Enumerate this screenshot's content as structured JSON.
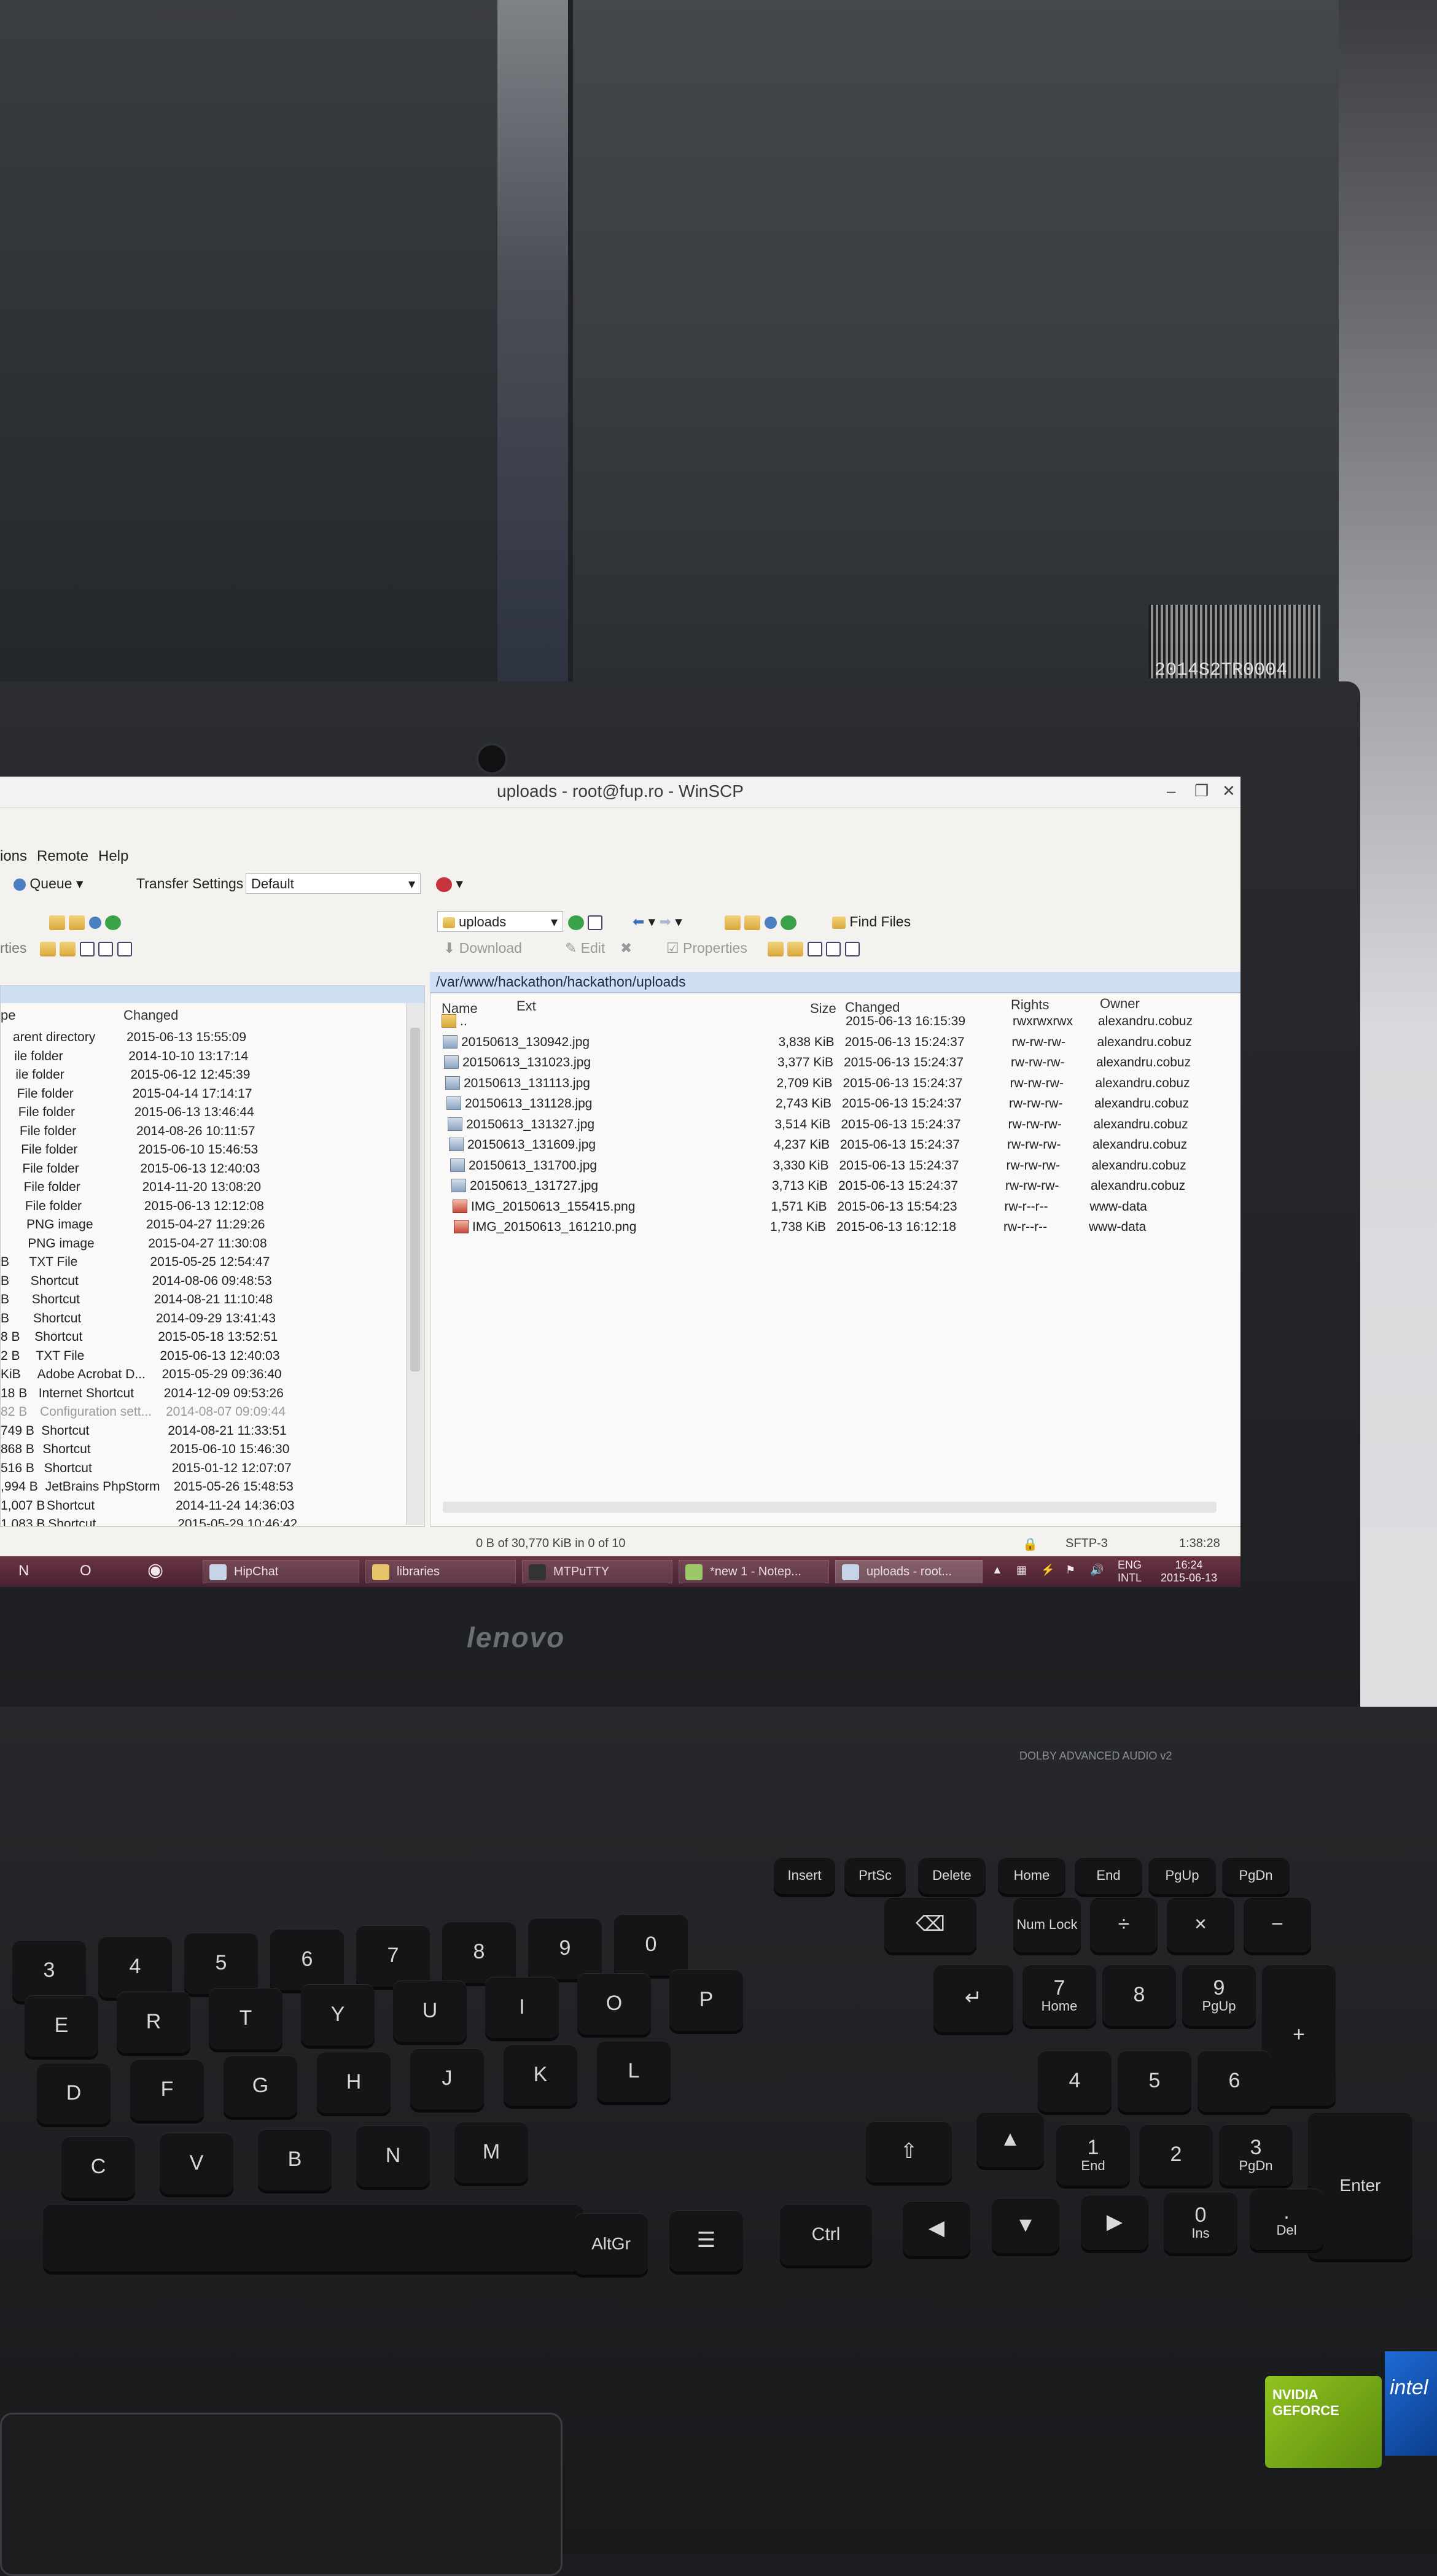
{
  "window": {
    "title": "uploads - root@fup.ro - WinSCP",
    "minimize": "–",
    "maximize": "❐",
    "close": "✕"
  },
  "menu": [
    "ions",
    "Remote",
    "Help"
  ],
  "toolbar": {
    "queue": "Queue",
    "transfer_settings": "Transfer Settings",
    "transfer_default": "Default",
    "remote_folder": "uploads",
    "find_files": "Find Files",
    "download": "Download",
    "edit": "Edit",
    "properties": "Properties",
    "left_props": "rties"
  },
  "remote_path": "/var/www/hackathon/hackathon/uploads",
  "left_pane": {
    "headers": {
      "type": "pe",
      "changed": "Changed"
    },
    "rows": [
      {
        "size": "",
        "type": "arent directory",
        "changed": "2015-06-13 15:55:09"
      },
      {
        "size": "",
        "type": "ile folder",
        "changed": "2014-10-10 13:17:14"
      },
      {
        "size": "",
        "type": "ile folder",
        "changed": "2015-06-12 12:45:39"
      },
      {
        "size": "",
        "type": "File folder",
        "changed": "2015-04-14 17:14:17"
      },
      {
        "size": "",
        "type": "File folder",
        "changed": "2015-06-13 13:46:44"
      },
      {
        "size": "",
        "type": "File folder",
        "changed": "2014-08-26 10:11:57"
      },
      {
        "size": "",
        "type": "File folder",
        "changed": "2015-06-10 15:46:53"
      },
      {
        "size": "",
        "type": "File folder",
        "changed": "2015-06-13 12:40:03"
      },
      {
        "size": "",
        "type": "File folder",
        "changed": "2014-11-20 13:08:20"
      },
      {
        "size": "",
        "type": "File folder",
        "changed": "2015-06-13 12:12:08"
      },
      {
        "size": "",
        "type": "PNG image",
        "changed": "2015-04-27 11:29:26"
      },
      {
        "size": "",
        "type": "PNG image",
        "changed": "2015-04-27 11:30:08"
      },
      {
        "size": "B",
        "type": "TXT File",
        "changed": "2015-05-25 12:54:47"
      },
      {
        "size": "B",
        "type": "Shortcut",
        "changed": "2014-08-06 09:48:53"
      },
      {
        "size": "B",
        "type": "Shortcut",
        "changed": "2014-08-21 11:10:48"
      },
      {
        "size": "B",
        "type": "Shortcut",
        "changed": "2014-09-29 13:41:43"
      },
      {
        "size": "8 B",
        "type": "Shortcut",
        "changed": "2015-05-18 13:52:51"
      },
      {
        "size": "2 B",
        "type": "TXT File",
        "changed": "2015-06-13 12:40:03"
      },
      {
        "size": "KiB",
        "type": "Adobe Acrobat D...",
        "changed": "2015-05-29 09:36:40"
      },
      {
        "size": "18 B",
        "type": "Internet Shortcut",
        "changed": "2014-12-09 09:53:26"
      },
      {
        "size": "82 B",
        "type": "Configuration sett...",
        "changed": "2014-08-07 09:09:44"
      },
      {
        "size": "749 B",
        "type": "Shortcut",
        "changed": "2014-08-21 11:33:51"
      },
      {
        "size": "868 B",
        "type": "Shortcut",
        "changed": "2015-06-10 15:46:30"
      },
      {
        "size": "516 B",
        "type": "Shortcut",
        "changed": "2015-01-12 12:07:07"
      },
      {
        "size": ",994 B",
        "type": "JetBrains PhpStorm",
        "changed": "2015-05-26 15:48:53"
      },
      {
        "size": "1,007 B",
        "type": "Shortcut",
        "changed": "2014-11-24 14:36:03"
      },
      {
        "size": "1,083 B",
        "type": "Shortcut",
        "changed": "2015-05-29 10:46:42"
      }
    ]
  },
  "right_pane": {
    "headers": {
      "name": "Name",
      "ext": "Ext",
      "size": "Size",
      "changed": "Changed",
      "rights": "Rights",
      "owner": "Owner"
    },
    "rows": [
      {
        "icon": "up",
        "name": "..",
        "size": "",
        "changed": "2015-06-13 16:15:39",
        "rights": "rwxrwxrwx",
        "owner": "alexandru.cobuz"
      },
      {
        "icon": "jpg",
        "name": "20150613_130942.jpg",
        "size": "3,838 KiB",
        "changed": "2015-06-13 15:24:37",
        "rights": "rw-rw-rw-",
        "owner": "alexandru.cobuz"
      },
      {
        "icon": "jpg",
        "name": "20150613_131023.jpg",
        "size": "3,377 KiB",
        "changed": "2015-06-13 15:24:37",
        "rights": "rw-rw-rw-",
        "owner": "alexandru.cobuz"
      },
      {
        "icon": "jpg",
        "name": "20150613_131113.jpg",
        "size": "2,709 KiB",
        "changed": "2015-06-13 15:24:37",
        "rights": "rw-rw-rw-",
        "owner": "alexandru.cobuz"
      },
      {
        "icon": "jpg",
        "name": "20150613_131128.jpg",
        "size": "2,743 KiB",
        "changed": "2015-06-13 15:24:37",
        "rights": "rw-rw-rw-",
        "owner": "alexandru.cobuz"
      },
      {
        "icon": "jpg",
        "name": "20150613_131327.jpg",
        "size": "3,514 KiB",
        "changed": "2015-06-13 15:24:37",
        "rights": "rw-rw-rw-",
        "owner": "alexandru.cobuz"
      },
      {
        "icon": "jpg",
        "name": "20150613_131609.jpg",
        "size": "4,237 KiB",
        "changed": "2015-06-13 15:24:37",
        "rights": "rw-rw-rw-",
        "owner": "alexandru.cobuz"
      },
      {
        "icon": "jpg",
        "name": "20150613_131700.jpg",
        "size": "3,330 KiB",
        "changed": "2015-06-13 15:24:37",
        "rights": "rw-rw-rw-",
        "owner": "alexandru.cobuz"
      },
      {
        "icon": "jpg",
        "name": "20150613_131727.jpg",
        "size": "3,713 KiB",
        "changed": "2015-06-13 15:24:37",
        "rights": "rw-rw-rw-",
        "owner": "alexandru.cobuz"
      },
      {
        "icon": "png",
        "name": "IMG_20150613_155415.png",
        "size": "1,571 KiB",
        "changed": "2015-06-13 15:54:23",
        "rights": "rw-r--r--",
        "owner": "www-data"
      },
      {
        "icon": "png",
        "name": "IMG_20150613_161210.png",
        "size": "1,738 KiB",
        "changed": "2015-06-13 16:12:18",
        "rights": "rw-r--r--",
        "owner": "www-data"
      }
    ]
  },
  "status": {
    "selection": "0 B of 30,770 KiB in 0 of 10",
    "protocol": "SFTP-3",
    "elapsed": "1:38:28"
  },
  "taskbar": {
    "items": [
      "HipChat",
      "libraries",
      "MTPuTTY",
      "*new 1 - Notep...",
      "uploads - root..."
    ],
    "lang": "ENG",
    "layout": "INTL",
    "time": "16:24",
    "date": "2015-06-13"
  },
  "laptop": {
    "brand": "lenovo",
    "dolby": "DOLBY ADVANCED AUDIO v2",
    "nvidia": "NVIDIA GEFORCE",
    "intel": "intel",
    "monitor_sticker": "2014S2TR0004"
  },
  "keys": {
    "insert": "Insert",
    "prtsc": "PrtSc",
    "delete": "Delete",
    "home": "Home",
    "end": "End",
    "pgup": "PgUp",
    "pgdn": "PgDn",
    "numlock": "Num Lock",
    "divide": "÷",
    "multiply": "×",
    "minus": "−",
    "plus": "+",
    "backspace": "⌫",
    "enter_main": "↵",
    "n7": "7",
    "n7sub": "Home",
    "n8": "8",
    "n9": "9",
    "n9sub": "PgUp",
    "n4": "4",
    "n5": "5",
    "n6": "6",
    "n1": "1",
    "n1sub": "End",
    "n2": "2",
    "n3": "3",
    "n3sub": "PgDn",
    "n0": "0",
    "n0sub": "Ins",
    "ndot": ".",
    "ndotsub": "Del",
    "enter": "Enter",
    "altgr": "AltGr",
    "menu": "☰",
    "ctrl": "Ctrl",
    "left": "◀",
    "down": "▼",
    "right": "▶",
    "up": "▲",
    "shift": "⇧",
    "row_digits": [
      "3",
      "4",
      "5",
      "6",
      "7",
      "8",
      "9",
      "0"
    ],
    "row_qwerty": [
      "E",
      "R",
      "T",
      "Y",
      "U",
      "I",
      "O",
      "P"
    ],
    "row_asdf": [
      "D",
      "F",
      "G",
      "H",
      "J",
      "K",
      "L"
    ],
    "row_zxcv": [
      "C",
      "V",
      "B",
      "N",
      "M"
    ]
  }
}
